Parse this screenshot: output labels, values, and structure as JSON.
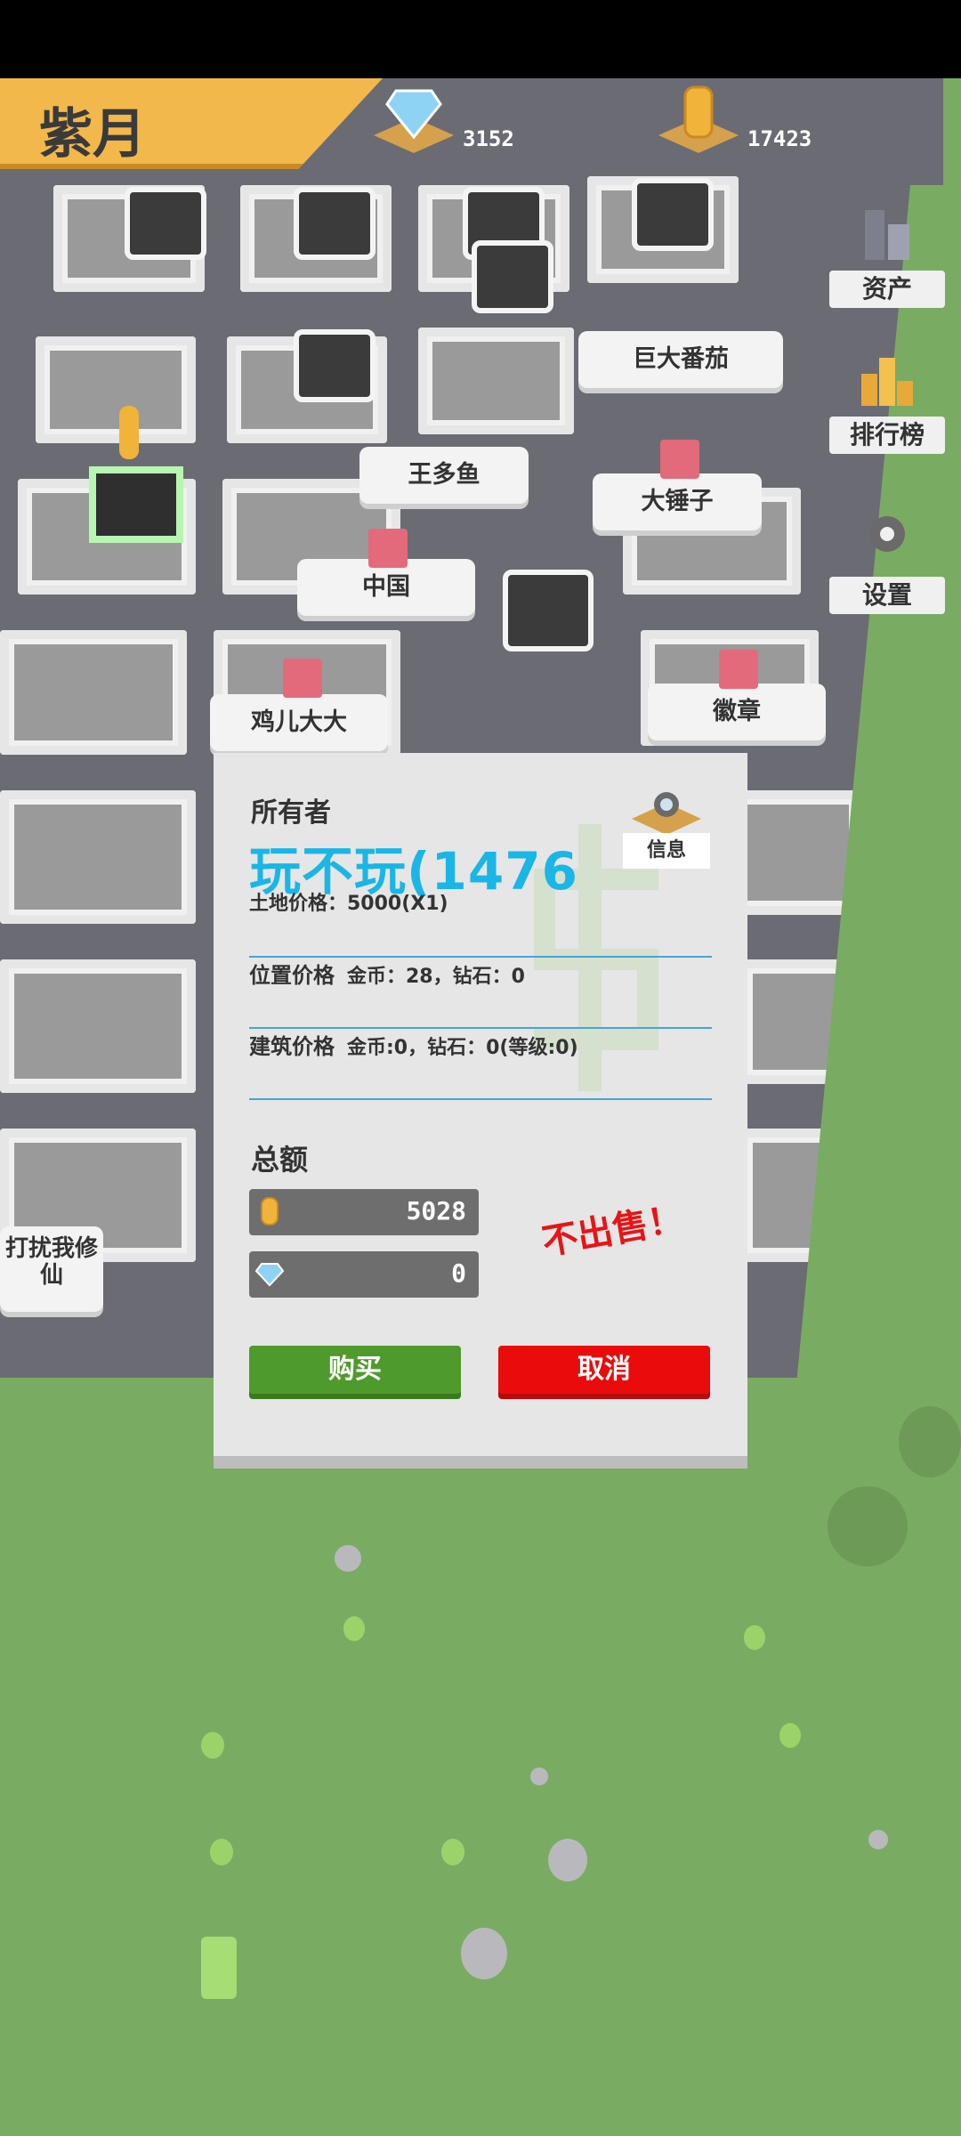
{
  "header": {
    "player_name": "紫月",
    "diamonds": "3152",
    "coins": "17423"
  },
  "side_menu": {
    "assets": "资产",
    "leaderboard": "排行榜",
    "settings": "设置"
  },
  "map_labels": {
    "l1": "巨大番茄",
    "l2": "王多鱼",
    "l3": "大锤子",
    "l4": "中国",
    "l5": "鸡儿大大",
    "l6": "徽章",
    "l7": "打扰我修",
    "l8": "仙"
  },
  "dialog": {
    "owner_label": "所有者",
    "owner_name": "玩不玩(1476",
    "info_label": "信息",
    "land_price": "土地价格：5000(X1)",
    "location_price_key": "位置价格",
    "location_price_val": "金币：28，钻石：0",
    "building_price_key": "建筑价格",
    "building_price_val": "金币:0，钻石：0(等级:0)",
    "total_label": "总额",
    "total_coins": "5028",
    "total_diamonds": "0",
    "not_for_sale": "不出售！",
    "buy_label": "购买",
    "cancel_label": "取消"
  },
  "colors": {
    "accent_blue": "#19b6e6",
    "buy_green": "#4f9a2c",
    "cancel_red": "#ea0c0c",
    "banner_gold": "#f2b84b"
  }
}
